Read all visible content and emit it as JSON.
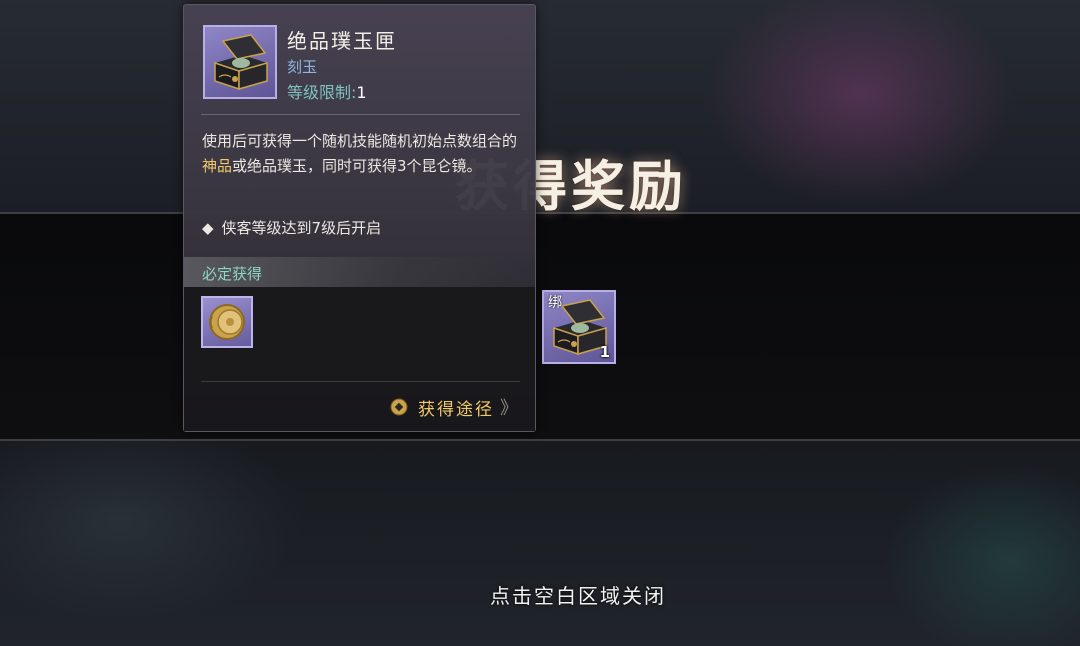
{
  "banner": {
    "title": "获得奖励"
  },
  "reward": {
    "bind_label": "绑",
    "quantity": "1",
    "icon": "jade-chest-icon"
  },
  "close_hint": "点击空白区域关闭",
  "tooltip": {
    "item_icon": "jade-chest-icon",
    "name": "绝品璞玉匣",
    "type": "刻玉",
    "level_label": "等级限制:",
    "level_value": "1",
    "desc_part1": "使用后可获得一个随机技能随机初始点数组合的",
    "desc_highlight": "神品",
    "desc_part2": "或绝品璞玉，同时可获得3个昆仑镜。",
    "condition_bullet": "◆",
    "condition": "侠客等级达到7级后开启",
    "section_label": "必定获得",
    "guaranteed_item_icon": "kunlun-mirror-icon",
    "obtain_label": "获得途径",
    "obtain_icon": "coin-icon",
    "obtain_arrows": "》"
  },
  "colors": {
    "highlight": "#f1cb6a",
    "item_frame_purple": "#8f86c7",
    "level_label": "#7fc3c0",
    "section_label": "#8fd6c8",
    "type_label": "#8fb6e0"
  }
}
